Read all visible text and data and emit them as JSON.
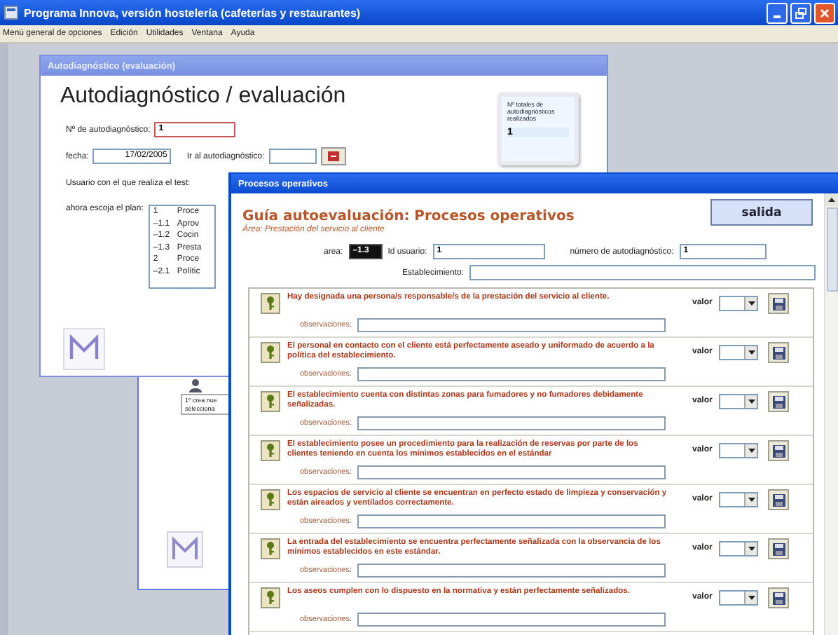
{
  "app": {
    "title": "Programa Innova, versión hostelería (cafeterías y restaurantes)"
  },
  "menu": [
    "Menú general de opciones",
    "Edición",
    "Utilidades",
    "Ventana",
    "Ayuda"
  ],
  "autodiagnostico_window": {
    "title": "Autodiagnóstico (evaluación)",
    "active": false,
    "heading": "Autodiagnóstico / evaluación",
    "number_label": "Nº de autodiagnóstico:",
    "number_value": "1",
    "date_label": "fecha:",
    "date_value": "17/02/2005",
    "goto_label": "Ir al autodiagnóstico:",
    "user_label": "Usuario con el que realiza el test:",
    "plan_label": "ahora escoja el plan:",
    "plan_items": [
      {
        "code": "1",
        "name": "Proce"
      },
      {
        "code": "–1.1",
        "name": "Aprov"
      },
      {
        "code": "–1.2",
        "name": "Cocin"
      },
      {
        "code": "–1.3",
        "name": "Presta"
      },
      {
        "code": "2",
        "name": "Proce"
      },
      {
        "code": "–2.1",
        "name": "Polític"
      }
    ],
    "totals_label": "Nº totales de autodiagnósticos realizados",
    "totals_value": "1"
  },
  "back_window": {
    "lines": [
      "1º crea nue",
      "selecciona"
    ]
  },
  "procesos_window": {
    "title": "Procesos operativos",
    "active": true,
    "heading": "Guía autoevaluación: Procesos operativos",
    "subtitle": "Área: Prestación del servicio al cliente",
    "exit_button": "salida",
    "area_label": "area:",
    "area_value": "–1.3",
    "user_label": "Id usuario:",
    "user_value": "1",
    "number_label": "número de autodiagnóstico:",
    "number_value": "1",
    "establishment_label": "Establecimiento:",
    "questions": [
      {
        "text": "Hay designada una persona/s responsable/s de la prestación del servicio al cliente.",
        "value_label": "valor",
        "observations_label": "observaciones:"
      },
      {
        "text": "El personal en contacto con el cliente está perfectamente aseado y uniformado de acuerdo a la política del establecimiento.",
        "value_label": "valor",
        "observations_label": "observaciones:"
      },
      {
        "text": "El establecimiento cuenta con distintas zonas para fumadores y no fumadores debidamente señalizadas.",
        "value_label": "valor",
        "observations_label": "observaciones:"
      },
      {
        "text": "El establecimiento posee un procedimiento para la realización de reservas por parte de los clientes teniendo en cuenta los mínimos establecidos en el estándar",
        "value_label": "valor",
        "observations_label": "observaciones:"
      },
      {
        "text": "Los espacios de servicio al cliente se encuentran en perfecto estado de limpieza y conservación y están aireados y ventilados correctamente.",
        "value_label": "valor",
        "observations_label": "observaciones:"
      },
      {
        "text": "La entrada del establecimiento se encuentra perfectamente señalizada con la observancia de los mínimos establecidos en este estándar.",
        "value_label": "valor",
        "observations_label": "observaciones:"
      },
      {
        "text": "Los aseos cumplen con lo dispuesto en la normativa y están perfectamente señalizados.",
        "value_label": "valor",
        "observations_label": "observaciones:"
      }
    ]
  }
}
